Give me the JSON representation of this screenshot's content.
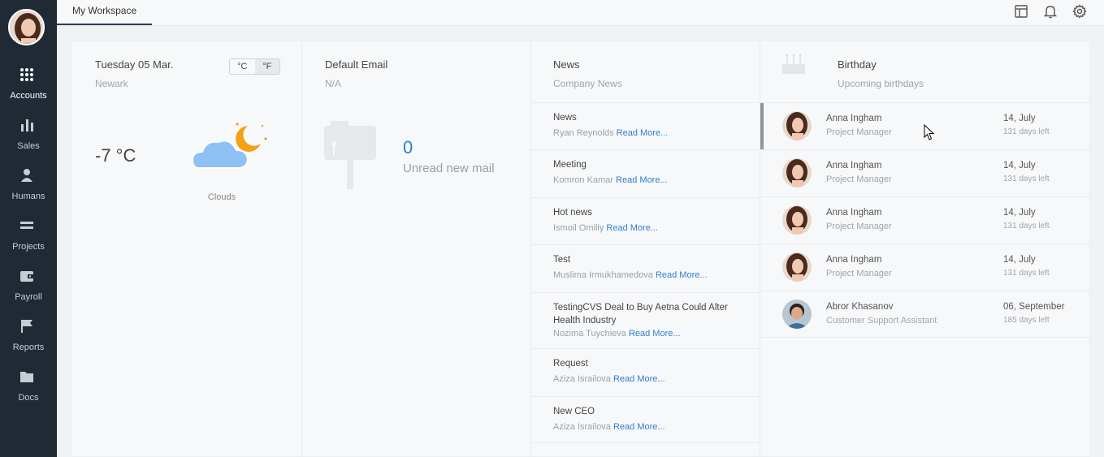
{
  "sidebar": {
    "items": [
      {
        "label": "Accounts",
        "icon": "grid-icon"
      },
      {
        "label": "Sales",
        "icon": "bar-chart-icon"
      },
      {
        "label": "Humans",
        "icon": "person-icon"
      },
      {
        "label": "Projects",
        "icon": "equals-icon"
      },
      {
        "label": "Payroll",
        "icon": "wallet-icon"
      },
      {
        "label": "Reports",
        "icon": "flag-icon"
      },
      {
        "label": "Docs",
        "icon": "folder-icon"
      }
    ],
    "active": "Accounts"
  },
  "header": {
    "tab": "My Workspace",
    "icons": [
      "layout-icon",
      "bell-icon",
      "gear-icon"
    ]
  },
  "weather": {
    "date": "Tuesday 05 Mar.",
    "city": "Newark",
    "units": [
      "°C",
      "°F"
    ],
    "selected_unit": "°F",
    "temperature": "-7 °C",
    "condition": "Clouds"
  },
  "email": {
    "title": "Default Email",
    "address": "N/A",
    "count": "0",
    "label": "Unread new mail"
  },
  "news": {
    "title": "News",
    "subtitle": "Company News",
    "read_more": "Read More...",
    "items": [
      {
        "title": "News",
        "author": "Ryan Reynolds"
      },
      {
        "title": "Meeting",
        "author": "Komron Kamar"
      },
      {
        "title": "Hot news",
        "author": "Ismoil Omiliy"
      },
      {
        "title": "Test",
        "author": "Muslima Irmukhamedova"
      },
      {
        "title": "TestingCVS Deal to Buy Aetna Could Alter Health Industry",
        "author": "Nozima Tuychieva"
      },
      {
        "title": "Request",
        "author": "Aziza Israilova"
      },
      {
        "title": "New CEO",
        "author": "Aziza Israilova"
      }
    ]
  },
  "birthday": {
    "title": "Birthday",
    "subtitle": "Upcoming birthdays",
    "items": [
      {
        "name": "Anna Ingham",
        "role": "Project Manager",
        "date": "14, July",
        "left": "131 days left"
      },
      {
        "name": "Anna Ingham",
        "role": "Project Manager",
        "date": "14, July",
        "left": "131 days left"
      },
      {
        "name": "Anna Ingham",
        "role": "Project Manager",
        "date": "14, July",
        "left": "131 days left"
      },
      {
        "name": "Anna Ingham",
        "role": "Project Manager",
        "date": "14, July",
        "left": "131 days left"
      },
      {
        "name": "Abror Khasanov",
        "role": "Customer Support Assistant",
        "date": "06, September",
        "left": "185 days left"
      }
    ]
  },
  "colors": {
    "sidebar_bg": "#1f2a35",
    "accent_link": "#2f7fcf",
    "sun": "#f4a018",
    "cloud": "#8ec1f4"
  }
}
